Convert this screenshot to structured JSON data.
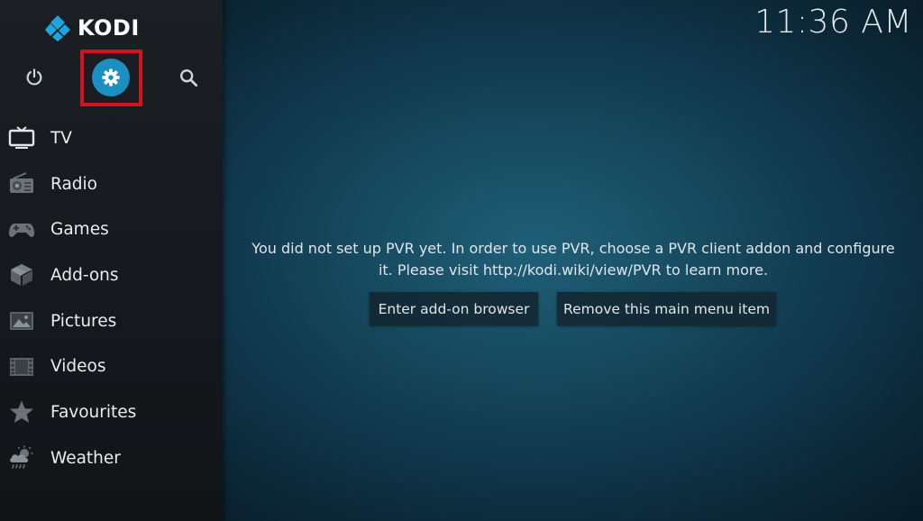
{
  "app": {
    "name": "KODI",
    "clock": "11:36 AM"
  },
  "top_buttons": [
    {
      "id": "power",
      "icon": "power-icon"
    },
    {
      "id": "settings",
      "icon": "gear-icon",
      "accent": "#1b8fc0"
    },
    {
      "id": "search",
      "icon": "search-icon"
    }
  ],
  "highlight": {
    "color": "#d4131f"
  },
  "sidebar": {
    "items": [
      {
        "label": "TV",
        "icon": "tv-icon"
      },
      {
        "label": "Radio",
        "icon": "radio-icon"
      },
      {
        "label": "Games",
        "icon": "gamepad-icon"
      },
      {
        "label": "Add-ons",
        "icon": "addons-box-icon"
      },
      {
        "label": "Pictures",
        "icon": "pictures-icon"
      },
      {
        "label": "Videos",
        "icon": "film-icon"
      },
      {
        "label": "Favourites",
        "icon": "star-icon"
      },
      {
        "label": "Weather",
        "icon": "weather-icon"
      }
    ]
  },
  "main": {
    "message_line1": "You did not set up PVR yet. In order to use PVR, choose a PVR client addon and configure",
    "message_line2": "it. Please visit http://kodi.wiki/view/PVR to learn more.",
    "buttons": {
      "enter_addon_browser": "Enter add-on browser",
      "remove_menu_item": "Remove this main menu item"
    }
  }
}
